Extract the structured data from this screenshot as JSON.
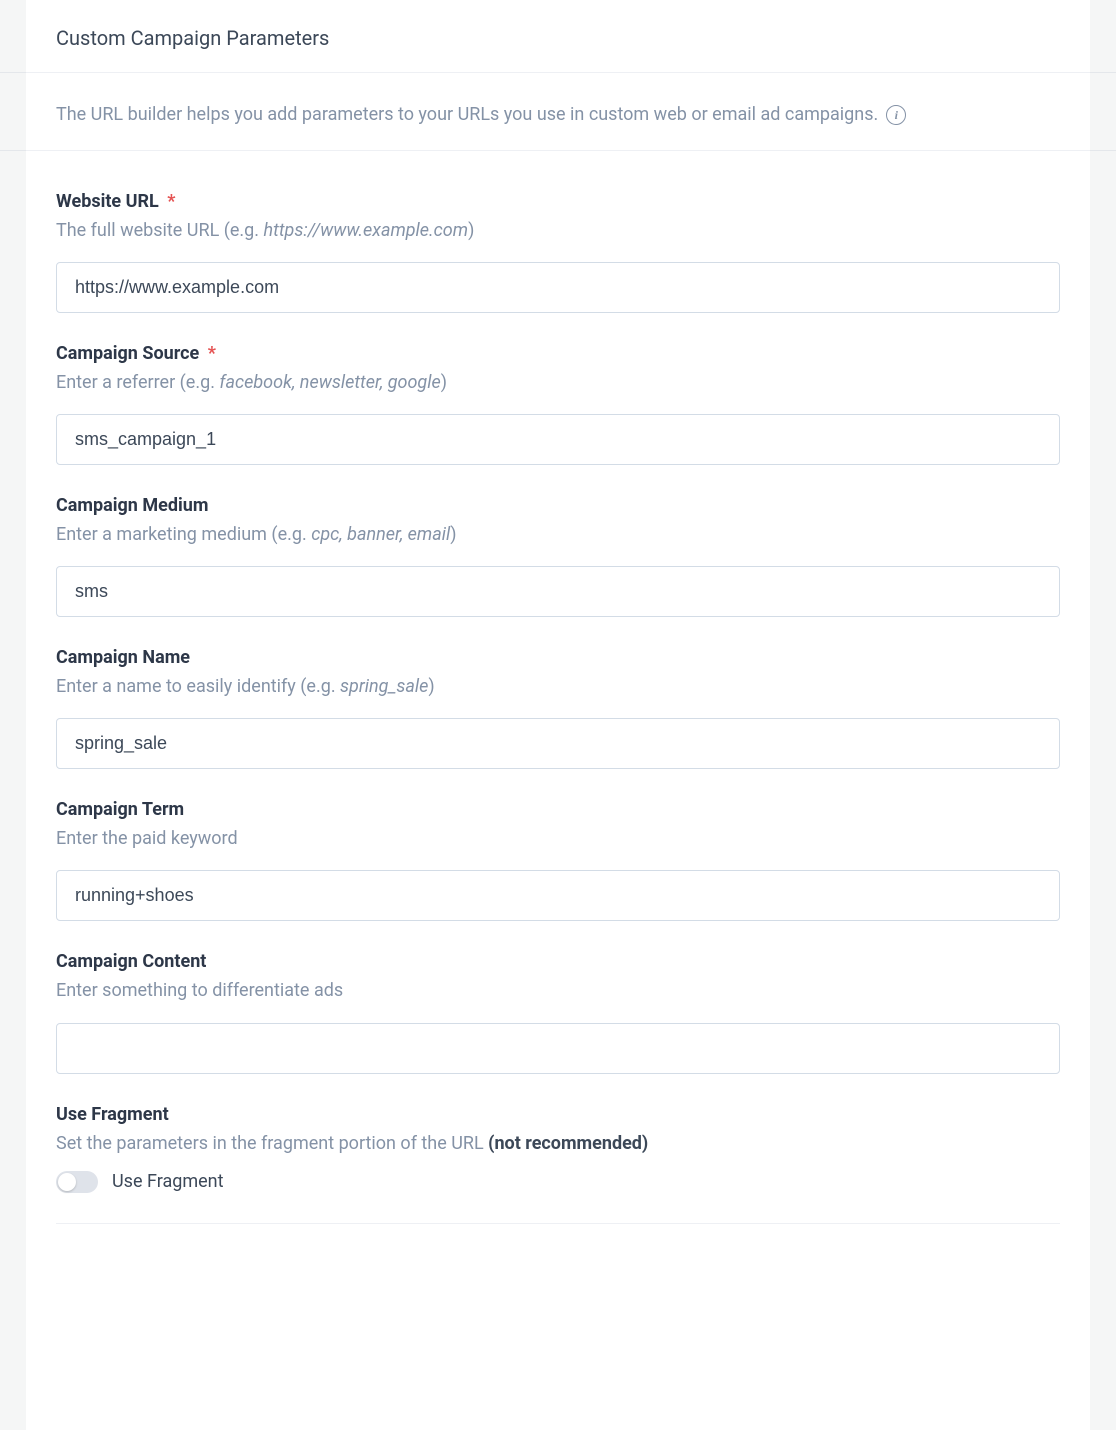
{
  "header": {
    "title": "Custom Campaign Parameters"
  },
  "intro": {
    "text": "The URL builder helps you add parameters to your URLs you use in custom web or email ad campaigns.",
    "info_icon": "info-icon"
  },
  "fields": {
    "website_url": {
      "label": "Website URL",
      "required": true,
      "help_prefix": "The full website URL (e.g. ",
      "help_example": "https://www.example.com",
      "help_suffix": ")",
      "value": "https://www.example.com",
      "placeholder": ""
    },
    "campaign_source": {
      "label": "Campaign Source",
      "required": true,
      "help_prefix": "Enter a referrer (e.g. ",
      "help_example": "facebook, newsletter, google",
      "help_suffix": ")",
      "value": "sms_campaign_1",
      "placeholder": ""
    },
    "campaign_medium": {
      "label": "Campaign Medium",
      "required": false,
      "help_prefix": "Enter a marketing medium (e.g. ",
      "help_example": "cpc, banner, email",
      "help_suffix": ")",
      "value": "sms",
      "placeholder": ""
    },
    "campaign_name": {
      "label": "Campaign Name",
      "required": false,
      "help_prefix": "Enter a name to easily identify (e.g. ",
      "help_example": "spring_sale",
      "help_suffix": ")",
      "value": "spring_sale",
      "placeholder": ""
    },
    "campaign_term": {
      "label": "Campaign Term",
      "required": false,
      "help_plain": "Enter the paid keyword",
      "value": "running+shoes",
      "placeholder": ""
    },
    "campaign_content": {
      "label": "Campaign Content",
      "required": false,
      "help_plain": "Enter something to differentiate ads",
      "value": "",
      "placeholder": ""
    },
    "use_fragment": {
      "label": "Use Fragment",
      "help_prefix": "Set the parameters in the fragment portion of the URL ",
      "help_bold": "(not recommended)",
      "toggle_label": "Use Fragment",
      "checked": false
    }
  }
}
